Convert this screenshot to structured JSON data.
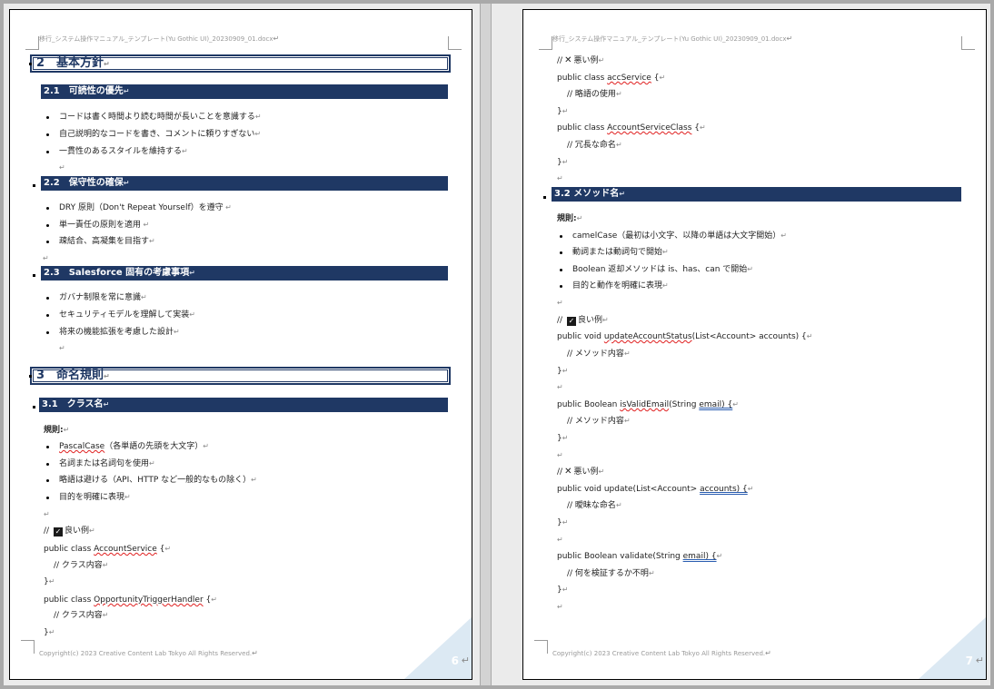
{
  "header": "移行_システム操作マニュアル_テンプレート(Yu Gothic UI)_20230909_01.docx",
  "footer": "Copyright(c) 2023 Creative Content Lab Tokyo All Rights Reserved.",
  "para_mark": "↵",
  "page6": {
    "page_number": "6",
    "h1_basic": "2　基本方針",
    "h2_readability": "2.1　可読性の優先",
    "readability_items": [
      "コードは書く時間より読む時間が長いことを意識する",
      "自己説明的なコードを書き、コメントに頼りすぎない",
      "一貫性のあるスタイルを維持する"
    ],
    "h2_maintainability": "2.2　保守性の確保",
    "maintainability_items": [
      "DRY 原則（Don't Repeat Yourself）を遵守",
      "単一責任の原則を適用",
      "疎結合、高凝集を目指す"
    ],
    "h2_salesforce": "2.3　Salesforce 固有の考慮事項",
    "salesforce_items": [
      "ガバナ制限を常に意識",
      "セキュリティモデルを理解して実装",
      "将来の機能拡張を考慮した設計"
    ],
    "h1_naming": "3　命名規則",
    "h2_class": "3.1　クラス名",
    "rules_label": "規則:",
    "class_rule_pascal": "PascalCase",
    "class_rule_pascal_rest": "（各単語の先頭を大文字）",
    "class_rules_rest": [
      "名詞または名詞句を使用",
      "略語は避ける（API、HTTP など一般的なもの除く）",
      "目的を明確に表現"
    ],
    "good_example": "良い例",
    "code_comment_prefix": "//",
    "code1_prefix": "public class ",
    "code1_name": "AccountService",
    "code1_suffix": " {",
    "class_content": "// クラス内容",
    "close_brace": "}",
    "code2_prefix": "public class ",
    "code2_name": "OpportunityTriggerHandler",
    "code2_suffix": " {"
  },
  "page7": {
    "page_number": "7",
    "bad_example": "悪い例",
    "code_comment_prefix": "//",
    "code_acc_prefix": "public class ",
    "code_acc_name": "accService",
    "code_acc_suffix": " {",
    "abbr_usage": "// 略語の使用",
    "close_brace": "}",
    "code_accsc_prefix": "public class ",
    "code_accsc_name": "AccountServiceClass",
    "code_accsc_suffix": " {",
    "redundant": "// 冗長な命名",
    "h2_method": "3.2 メソッド名",
    "rules_label": "規則:",
    "method_rules": [
      "camelCase（最初は小文字、以降の単語は大文字開始）",
      "動詞または動詞句で開始",
      "Boolean 返却メソッドは is、has、can で開始",
      "目的と動作を明確に表現"
    ],
    "good_example": "良い例",
    "code_upd_prefix": "public void ",
    "code_upd_name": "updateAccountStatus",
    "code_upd_suffix": "(List<Account> accounts) {",
    "method_content": "// メソッド内容",
    "code_valid_prefix": "public Boolean ",
    "code_valid_name": "isValidEmail",
    "code_valid_mid": "(String ",
    "code_valid_arg": "email) {",
    "code_update_prefix": "public void update(List<Account> ",
    "code_update_arg": "accounts) {",
    "ambiguous": "// 曖昧な命名",
    "code_validate_prefix": "public Boolean validate(String ",
    "code_validate_arg": "email) {",
    "unclear": "// 何を検証するか不明"
  }
}
